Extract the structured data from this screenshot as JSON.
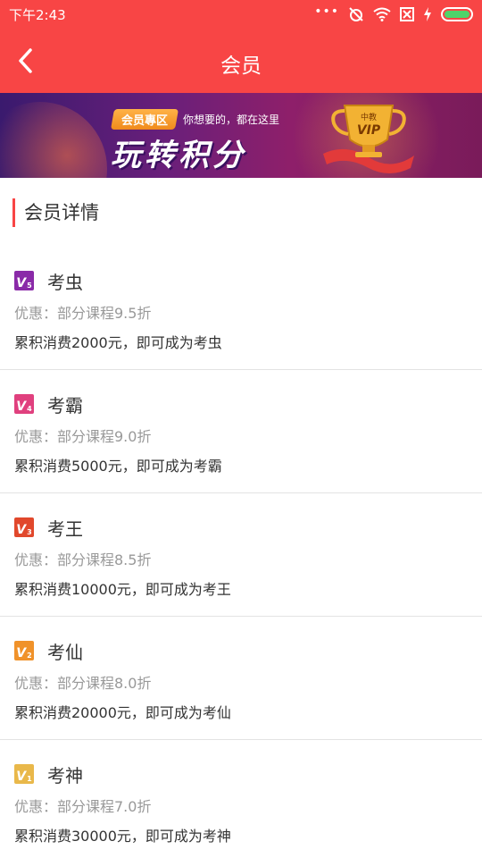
{
  "status_bar": {
    "time": "下午2:43",
    "icons": [
      "more-dots-icon",
      "alarm-off-icon",
      "wifi-icon",
      "sim-off-icon",
      "charging-icon",
      "battery-icon"
    ],
    "battery_color": "#4fd36a"
  },
  "header": {
    "title": "会员",
    "back_icon": "chevron-left-icon",
    "background": "#f84545"
  },
  "banner": {
    "tag": "会员專区",
    "subtitle": "你想要的，都在这里",
    "headline": "玩转积分",
    "trophy_top": "中教",
    "trophy_label": "VIP"
  },
  "section": {
    "title": "会员详情",
    "accent": "#f84545"
  },
  "levels": [
    {
      "badge": "V",
      "badge_num": "5",
      "badge_color": "#8a2aa8",
      "name": "考虫",
      "discount": "优惠：部分课程9.5折",
      "requirement": "累积消费2000元，即可成为考虫"
    },
    {
      "badge": "V",
      "badge_num": "4",
      "badge_color": "#e0407e",
      "name": "考霸",
      "discount": "优惠：部分课程9.0折",
      "requirement": "累积消费5000元，即可成为考霸"
    },
    {
      "badge": "V",
      "badge_num": "3",
      "badge_color": "#e1482c",
      "name": "考王",
      "discount": "优惠：部分课程8.5折",
      "requirement": "累积消费10000元，即可成为考王"
    },
    {
      "badge": "V",
      "badge_num": "2",
      "badge_color": "#f0922a",
      "name": "考仙",
      "discount": "优惠：部分课程8.0折",
      "requirement": "累积消费20000元，即可成为考仙"
    },
    {
      "badge": "V",
      "badge_num": "1",
      "badge_color": "#e9b84a",
      "name": "考神",
      "discount": "优惠：部分课程7.0折",
      "requirement": "累积消费30000元，即可成为考神"
    }
  ]
}
